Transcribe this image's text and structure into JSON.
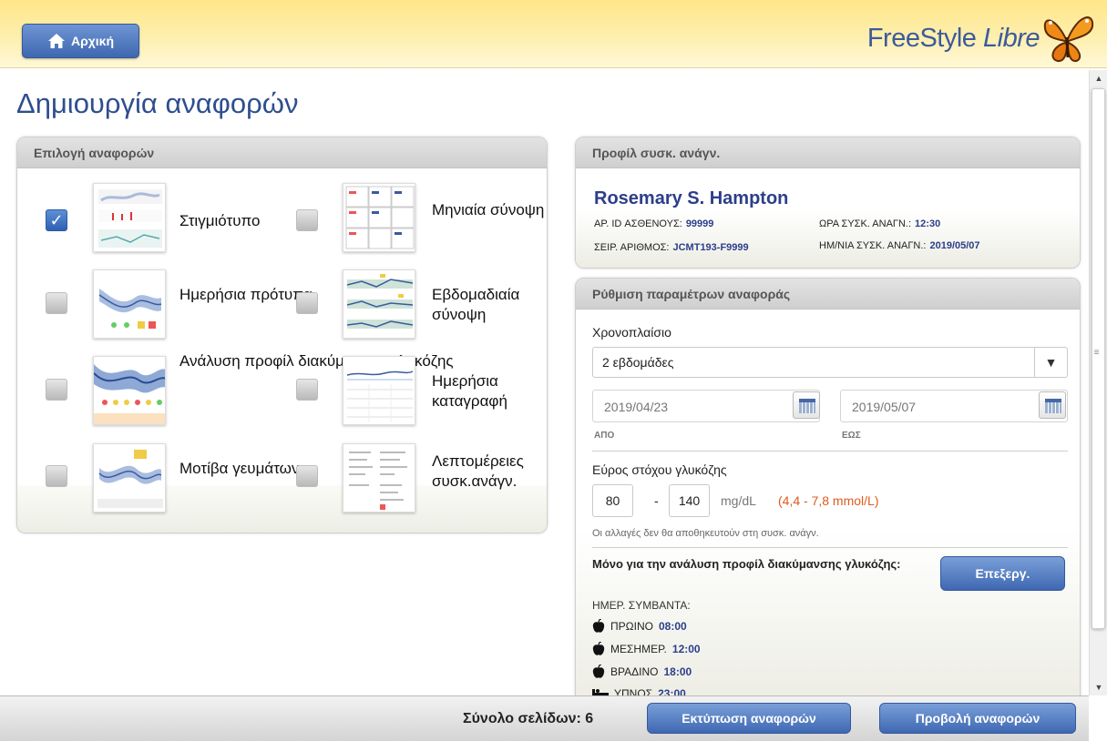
{
  "header": {
    "home_label": "Αρχική",
    "logo_text": "FreeStyle",
    "logo_italic": "Libre"
  },
  "page_title": "Δημιουργία αναφορών",
  "reports_panel": {
    "title": "Επιλογή αναφορών",
    "items": [
      {
        "label": "Στιγμιότυπο",
        "checked": true
      },
      {
        "label": "Μηνιαία σύνοψη",
        "checked": false
      },
      {
        "label": "Ημερήσια πρότυπα",
        "checked": false
      },
      {
        "label": "Εβδομαδιαία σύνοψη",
        "checked": false
      },
      {
        "label": "Ανάλυση προφίλ διακύμανσης γλυκόζης",
        "checked": false
      },
      {
        "label": "Ημερήσια καταγραφή",
        "checked": false
      },
      {
        "label": "Μοτίβα γευμάτων",
        "checked": false
      },
      {
        "label": "Λεπτομέρειες συσκ.ανάγν.",
        "checked": false
      }
    ]
  },
  "profile_panel": {
    "title": "Προφίλ συσκ. ανάγν.",
    "name": "Rosemary S. Hampton",
    "patient_id_label": "ΑΡ. ID ΑΣΘΕΝΟΥΣ:",
    "patient_id": "99999",
    "serial_label": "ΣΕΙΡ. ΑΡΙΘΜΟΣ:",
    "serial": "JCMT193-F9999",
    "time_label": "ΩΡΑ ΣΥΣΚ. ΑΝΑΓΝ.:",
    "time": "12:30",
    "date_label": "ΗΜ/ΝΙΑ ΣΥΣΚ. ΑΝΑΓΝ.:",
    "date": "2019/05/07"
  },
  "settings_panel": {
    "title": "Ρύθμιση παραμέτρων αναφοράς",
    "timeframe_label": "Χρονοπλαίσιο",
    "timeframe_value": "2 εβδομάδες",
    "from_date": "2019/04/23",
    "from_label": "ΑΠΟ",
    "to_date": "2019/05/07",
    "to_label": "ΕΩΣ",
    "target_label": "Εύρος στόχου γλυκόζης",
    "target_low": "80",
    "target_sep": "-",
    "target_high": "140",
    "target_unit": "mg/dL",
    "target_mmol": "(4,4 - 7,8 mmol/L)",
    "note": "Οι αλλαγές δεν θα αποθηκευτούν στη συσκ. ανάγν.",
    "agp_title": "Μόνο για την ανάλυση προφίλ διακύμανσης γλυκόζης:",
    "edit_label": "Επεξεργ.",
    "daily_events_label": "ΗΜΕΡ. ΣΥΜΒΑΝΤΑ:",
    "events": [
      {
        "label": "ΠΡΩΙΝΟ",
        "time": "08:00"
      },
      {
        "label": "ΜΕΣΗΜΕΡ.",
        "time": "12:00"
      },
      {
        "label": "ΒΡΑΔΙΝΟ",
        "time": "18:00"
      },
      {
        "label": "ΥΠΝΟΣ",
        "time": "23:00"
      }
    ]
  },
  "footer": {
    "total_label": "Σύνολο σελίδων: 6",
    "print_label": "Εκτύπωση αναφορών",
    "view_label": "Προβολή αναφορών"
  },
  "colors": {
    "accent_blue": "#3f68b2",
    "title_blue": "#2e4e8f",
    "mmol_orange": "#e05a1f",
    "header_yellow": "#fee688"
  }
}
